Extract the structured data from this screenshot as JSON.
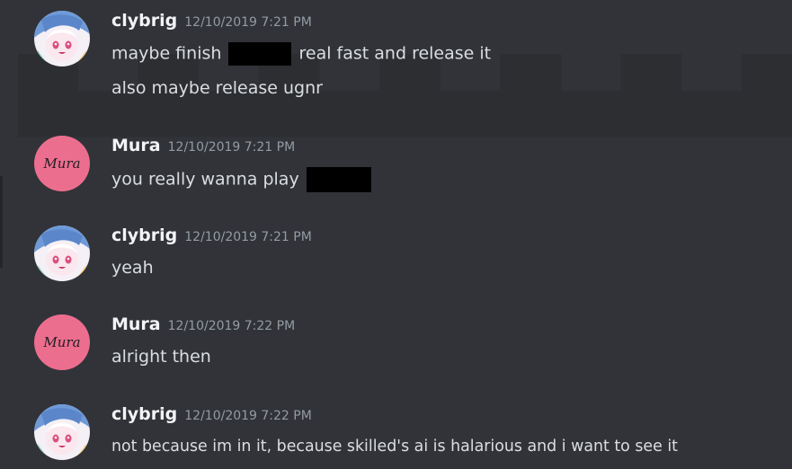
{
  "messages": [
    {
      "author": "clybrig",
      "timestamp": "12/10/2019 7:21 PM",
      "lines": [
        {
          "before": "maybe finish",
          "after": "real fast and release it"
        },
        {
          "text": "also maybe release ugnr"
        }
      ]
    },
    {
      "author": "Mura",
      "avatar_text": "Mura",
      "timestamp": "12/10/2019 7:21 PM",
      "lines": [
        {
          "before": "you really wanna play"
        }
      ]
    },
    {
      "author": "clybrig",
      "timestamp": "12/10/2019 7:21 PM",
      "lines": [
        {
          "text": "yeah"
        }
      ]
    },
    {
      "author": "Mura",
      "avatar_text": "Mura",
      "timestamp": "12/10/2019 7:22 PM",
      "lines": [
        {
          "text": "alright then"
        }
      ]
    },
    {
      "author": "clybrig",
      "timestamp": "12/10/2019 7:22 PM",
      "lines": [
        {
          "text": "not because im in it, because skilled's ai is halarious and i want to see it"
        }
      ]
    }
  ],
  "colors": {
    "background": "#313338",
    "username": "#f2f3f5",
    "timestamp": "#949ba4",
    "message_text": "#dbdee1",
    "mura_avatar": "#ec6e8f",
    "redaction": "#000000"
  },
  "icons": {
    "clybrig_avatar": "anime-character-avatar-icon",
    "mura_avatar": "mura-text-avatar-icon"
  }
}
